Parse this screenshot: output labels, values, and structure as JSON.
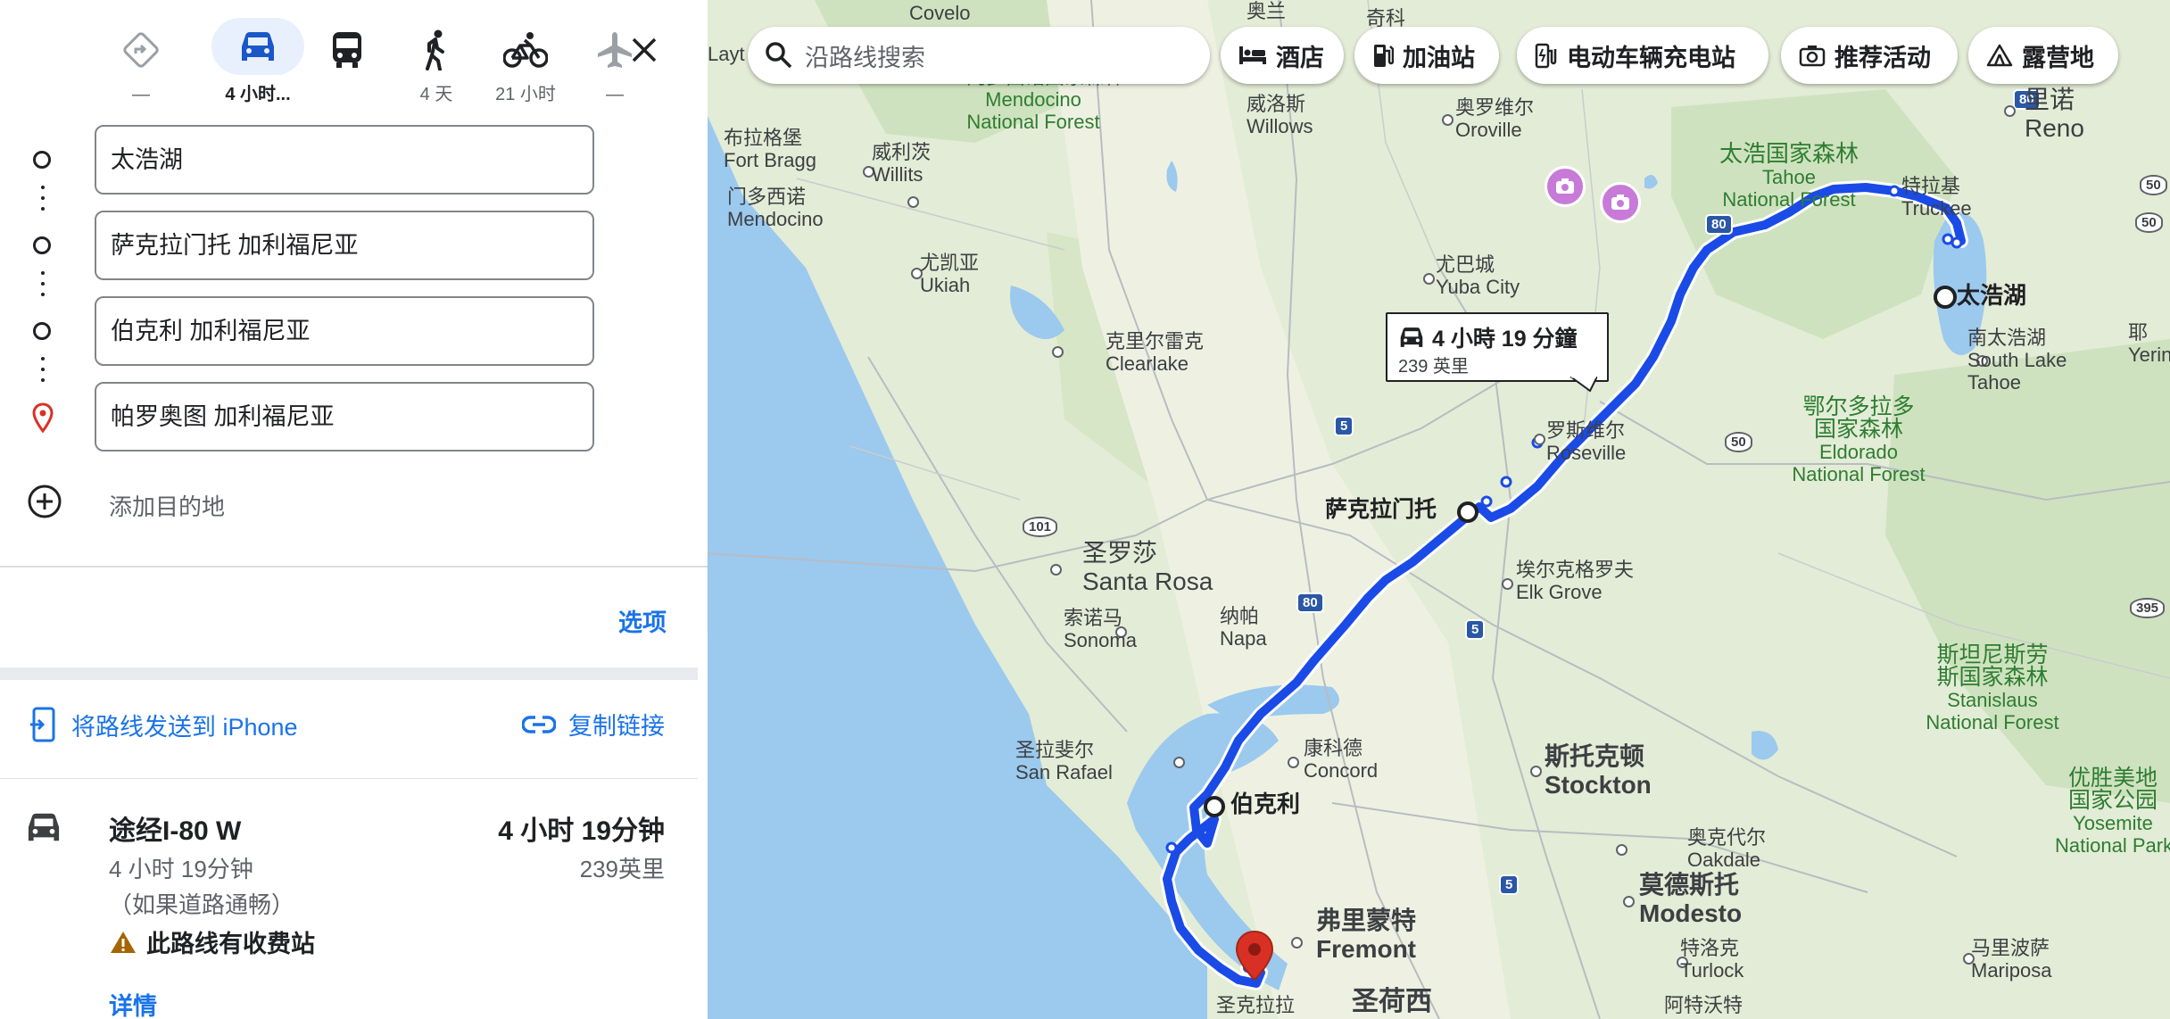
{
  "travel_modes": [
    {
      "name": "best",
      "label": "—"
    },
    {
      "name": "driving",
      "label": "4 小时..."
    },
    {
      "name": "transit",
      "label": ""
    },
    {
      "name": "walking",
      "label": "4 天"
    },
    {
      "name": "cycling",
      "label": "21 小时"
    },
    {
      "name": "flights",
      "label": "—"
    }
  ],
  "stops": [
    "太浩湖",
    "萨克拉门托 加利福尼亚",
    "伯克利 加利福尼亚",
    "帕罗奥图 加利福尼亚"
  ],
  "add_destination": "添加目的地",
  "options_label": "选项",
  "share": {
    "send_to_phone": "将路线发送到 iPhone",
    "copy_link": "复制链接"
  },
  "route": {
    "via": "途经I-80 W",
    "duration_big": "4 小时 19分钟",
    "duration_sub": "4 小时 19分钟",
    "distance": "239英里",
    "traffic_note": "（如果道路通畅）",
    "toll_warning": "此路线有收费站",
    "details": "详情"
  },
  "map": {
    "search_placeholder": "沿路线搜索",
    "chips": [
      "酒店",
      "加油站",
      "电动车辆充电站",
      "推荐活动",
      "露营地"
    ],
    "callout": {
      "duration": "4 小時 19 分鐘",
      "distance": "239 英里"
    },
    "labels": {
      "covelo": "Covelo",
      "laytonville": "Layt",
      "aolan": "奥兰",
      "qike": "奇科",
      "mendocino_nf_cn": "门多西诺国家森林",
      "mendocino_nf_en1": "Mendocino",
      "mendocino_nf_en2": "National Forest",
      "willows_cn": "威洛斯",
      "willows_en": "Willows",
      "oroville_cn": "奥罗维尔",
      "oroville_en": "Oroville",
      "fortbragg_cn": "布拉格堡",
      "fortbragg_en": "Fort Bragg",
      "willits_cn": "威利茨",
      "willits_en": "Willits",
      "mendocino_cn": "门多西诺",
      "mendocino_en": "Mendocino",
      "tahoe_nf_cn": "太浩国家森林",
      "tahoe_nf_en1": "Tahoe",
      "tahoe_nf_en2": "National Forest",
      "truckee_cn": "特拉基",
      "truckee_en": "Truckee",
      "reno_cn": "里诺",
      "reno_en": "Reno",
      "ukiah_cn": "尤凯亚",
      "ukiah_en": "Ukiah",
      "yubacity_cn": "尤巴城",
      "yubacity_en": "Yuba City",
      "laketahoe": "太浩湖",
      "southlaketahoe_cn": "南太浩湖",
      "southlaketahoe_en1": "South Lake",
      "southlaketahoe_en2": "Tahoe",
      "yerin": "耶\nYerin",
      "clearlake_cn": "克里尔雷克",
      "clearlake_en": "Clearlake",
      "roseville_cn": "罗斯维尔",
      "roseville_en": "Roseville",
      "eldorado_cn1": "鄂尔多拉多",
      "eldorado_cn2": "国家森林",
      "eldorado_en1": "Eldorado",
      "eldorado_en2": "National Forest",
      "sacramento": "萨克拉门托",
      "santarosa_cn": "圣罗莎",
      "santarosa_en": "Santa Rosa",
      "elkgrove_cn": "埃尔克格罗夫",
      "elkgrove_en": "Elk Grove",
      "sonoma_cn": "索诺马",
      "sonoma_en": "Sonoma",
      "napa_cn": "纳帕",
      "napa_en": "Napa",
      "stanislaus_cn1": "斯坦尼斯劳",
      "stanislaus_cn2": "斯国家森林",
      "stanislaus_en1": "Stanislaus",
      "stanislaus_en2": "National Forest",
      "sanrafael_cn": "圣拉斐尔",
      "sanrafael_en": "San Rafael",
      "concord_cn": "康科德",
      "concord_en": "Concord",
      "stockton_cn": "斯托克顿",
      "stockton_en": "Stockton",
      "berkeley": "伯克利",
      "yosemite_cn1": "优胜美地",
      "yosemite_cn2": "国家公园",
      "yosemite_en1": "Yosemite",
      "yosemite_en2": "National Park",
      "oakdale_cn": "奥克代尔",
      "oakdale_en": "Oakdale",
      "modesto_cn": "莫德斯托",
      "modesto_en": "Modesto",
      "fremont_cn": "弗里蒙特",
      "fremont_en": "Fremont",
      "turlock_cn": "特洛克",
      "turlock_en": "Turlock",
      "mariposa_cn": "马里波萨",
      "mariposa_en": "Mariposa",
      "santaclara": "圣克拉拉",
      "sanjose": "圣荷西",
      "atwater": "阿特沃特"
    },
    "shields": {
      "i80a": "80",
      "i80b": "80",
      "i80c": "80",
      "i5a": "5",
      "i5b": "5",
      "i5c": "5",
      "us101": "101",
      "us50a": "50",
      "us50b": "50",
      "us50c": "50",
      "us395": "395"
    }
  },
  "colors": {
    "route": "#1a4be6",
    "accent": "#1a73e8",
    "water": "#9cc9ee",
    "land": "#e3ecd6"
  }
}
